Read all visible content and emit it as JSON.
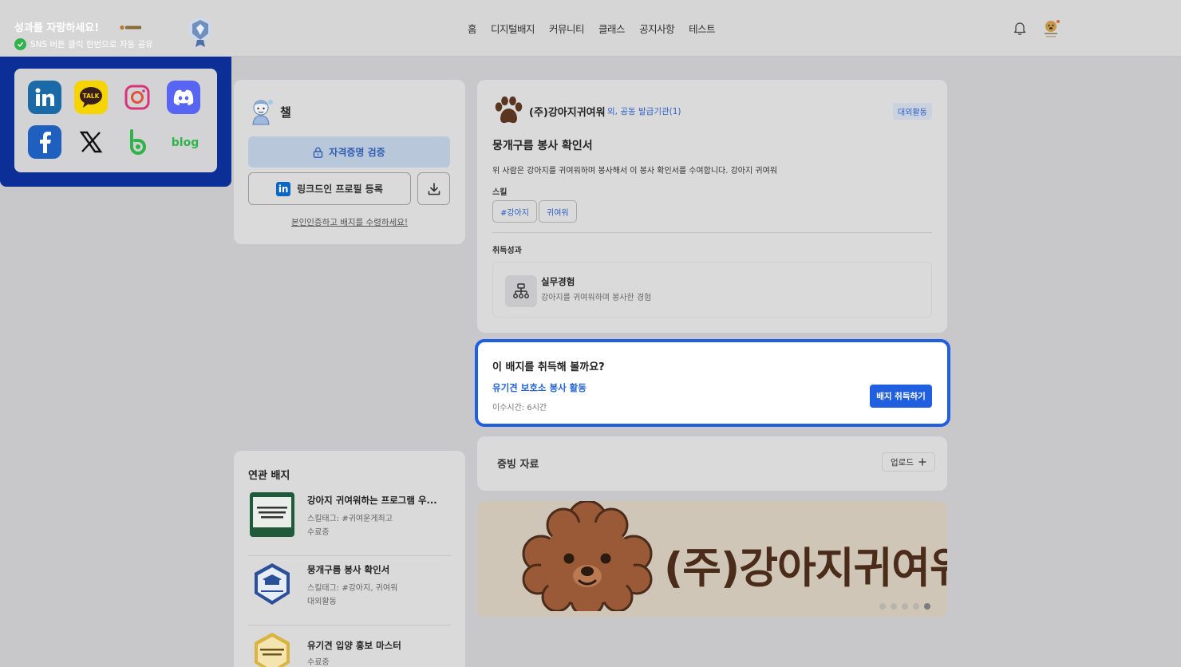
{
  "nav": {
    "items": [
      "홈",
      "디지털배지",
      "커뮤니티",
      "클래스",
      "공지사항",
      "테스트"
    ]
  },
  "profile": {
    "name": "챌",
    "verify_label": "자격증명 검증",
    "linkedin_label": "링크드인 프로필 등록",
    "verify_link": "본인인증하고 배지를 수령하세요!"
  },
  "share": {
    "title": "성과를 자랑하세요!",
    "subtitle": "SNS 버튼 클릭 한번으로 자동 공유",
    "icons": [
      "linkedin-icon",
      "kakaotalk-icon",
      "instagram-icon",
      "discord-icon",
      "facebook-icon",
      "x-icon",
      "band-icon",
      "blog-icon"
    ],
    "kakao_text": "TALK",
    "blog_text": "blog"
  },
  "related": {
    "title": "연관 배지",
    "items": [
      {
        "title": "강아지 귀여워하는 프로그램 우...",
        "tags": "스킬태그: #귀여운게최고",
        "type": "수료증"
      },
      {
        "title": "뭉개구름 봉사 확인서",
        "tags": "스킬태그: #강아지, 귀여워",
        "type": "대외활동"
      },
      {
        "title": "유기견 입양 홍보 마스터",
        "tags": "",
        "type": "수료증"
      }
    ]
  },
  "badge": {
    "issuer": "(주)강아지귀여워",
    "issuer_extra": "외, 공동 발급기관(1)",
    "category": "대외활동",
    "title": "뭉개구름 봉사 확인서",
    "description": "위 사람은 강아지를 귀여워하며 봉사해서 이 봉사 확인서를 수여합니다. 강아지 귀여워",
    "skill_label": "스킬",
    "skills": [
      "#강아지",
      "귀여워"
    ],
    "achievement_label": "취득성과",
    "achievement": {
      "title": "실무경험",
      "description": "강아지를 귀여워하며 봉사한 경험"
    }
  },
  "acquire": {
    "title": "이 배지를 취득해 볼까요?",
    "program": "유기견 보호소 봉사 활동",
    "duration": "이수시간: 6시간",
    "button": "배지 취득하기"
  },
  "evidence": {
    "title": "증빙 자료",
    "upload_label": "업로드"
  },
  "banner": {
    "text": "(주)강아지귀여워",
    "slides": 5,
    "active_slide": 5
  },
  "colors": {
    "accent": "#1f5fe0",
    "share_bg": "#0b2f96",
    "banner_bg": "#cfc6b8",
    "dog_brown": "#9a5a38"
  }
}
